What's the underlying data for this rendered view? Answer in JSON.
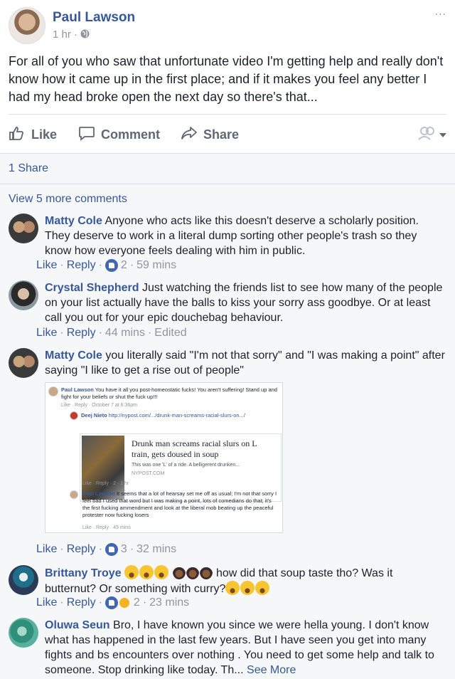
{
  "post": {
    "author": "Paul Lawson",
    "time": "1 hr",
    "meta_sep": " · ",
    "more": "...",
    "text": "For all of you who saw that unfortunate video I'm getting help and really don't know how it came up in the first place; and if it makes you feel any better I had my head broke open the next day so there's that..."
  },
  "actions": {
    "like": "Like",
    "comment": "Comment",
    "share": "Share"
  },
  "shares": "1 Share",
  "view_more": "View 5 more comments",
  "comments": [
    {
      "name": "Matty Cole",
      "text": "Anyone who acts like this doesn't deserve a scholarly position. They deserve to work in a literal dump sorting other people's trash so they know how everyone feels dealing with him in public.",
      "like": "Like",
      "reply": "Reply",
      "reactions": "2",
      "time": "59 mins"
    },
    {
      "name": "Crystal Shepherd",
      "text": "Just watching the friends list to see how many of the people on your list actually have the balls to kiss your sorry ass goodbye. Or at least call you out for your epic douchebag behaviour.",
      "like": "Like",
      "reply": "Reply",
      "time": "44 mins",
      "edited": "Edited"
    },
    {
      "name": "Matty Cole",
      "text": "you literally said \"I'm not that sorry\" and \"I was making a point\" after saying \"I like to get a rise out of people\"",
      "like": "Like",
      "reply": "Reply",
      "reactions": "3",
      "time": "32 mins"
    },
    {
      "name": "Brittany Troye",
      "text": "how did that soup taste tho? Was it butternut? Or something with curry?",
      "like": "Like",
      "reply": "Reply",
      "reactions": "2",
      "time": "23 mins"
    },
    {
      "name": "Oluwa Seun",
      "text": "Bro, I have known you since we were hella young. I don't know what has happened in the last few years. But I have seen you get into many fights and bs encounters over nothing . You need to get some help and talk to someone. Stop drinking like today. Th...",
      "see_more": "See More"
    }
  ],
  "screenshot": {
    "c1_name": "Paul Lawson",
    "c1_text": "You have it all you post-homeostatic fucks! You aren't suffering! Stand up and fight for your beliefs or shut the fuck up!!!",
    "c1_meta": "Like · Reply · October 7 at 6:36pm",
    "c2_name": "Deej Nieto",
    "c2_link": "http://nypost.com/.../drunk-man-screams-racial-slurs-on.../",
    "card_title": "Drunk man screams racial slurs on L train, gets doused in soup",
    "card_desc": "This was one 'L' of a ride. A belligerent drunken...",
    "card_src": "NYPOST.COM",
    "c2_meta": "Like · Reply · 2 · 1 hr",
    "c3_name": "Paul Lawson",
    "c3_text": "It seems that a lot of hearsay set me off as usual; I'm not that sorry I feel bad I used that word but I was making a point, lots of comedians do that; it's the first fucking ammendment and look at the liberal mob beating up the peaceful protester now fucking losers",
    "c3_meta": "Like · Reply · 45 mins"
  },
  "colors": {
    "link": "#365899",
    "meta": "#90949c",
    "like": "#4267b2",
    "bg": "#f6f7f9"
  }
}
